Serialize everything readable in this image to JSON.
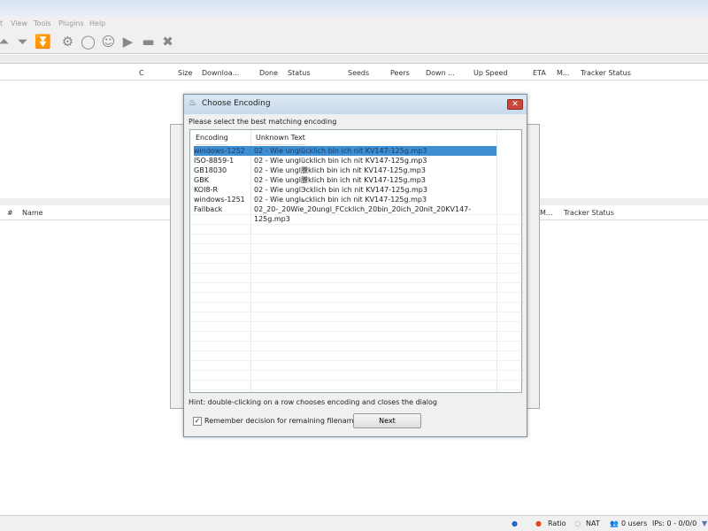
{
  "menu": [
    "t",
    "View",
    "Tools",
    "Plugins",
    "Help"
  ],
  "toolbar_icons": [
    "add-icon",
    "remove-icon",
    "remove-all-icon",
    "settings-icon",
    "resume-icon",
    "pause-icon",
    "play-icon",
    "stop-icon",
    "close-icon"
  ],
  "top_columns": [
    "C",
    "Size",
    "Downloa...",
    "Done",
    "Status",
    "Seeds",
    "Peers",
    "Down ...",
    "Up Speed",
    "ETA",
    "M...",
    "Tracker Status"
  ],
  "lower_columns": [
    "#",
    "Name",
    "M...",
    "Tracker Status"
  ],
  "dialog": {
    "title": "Choose Encoding",
    "prompt": "Please select the best matching encoding",
    "columns": [
      "Encoding",
      "Unknown Text"
    ],
    "rows": [
      {
        "encoding": "windows-1252",
        "text": "02 - Wie unglücklich bin ich nit KV147-125g.mp3",
        "selected": true
      },
      {
        "encoding": "ISO-8859-1",
        "text": "02 - Wie unglücklich bin ich nit KV147-125g.mp3"
      },
      {
        "encoding": "GB18030",
        "text": "02 - Wie ungl黱klich bin ich nit KV147-125g.mp3"
      },
      {
        "encoding": "GBK",
        "text": "02 - Wie ungl黱klich bin ich nit KV147-125g.mp3"
      },
      {
        "encoding": "KOI8-R",
        "text": "02 - Wie unglЭcklich bin ich nit KV147-125g.mp3"
      },
      {
        "encoding": "windows-1251",
        "text": "02 - Wie unglьcklich bin ich nit KV147-125g.mp3"
      },
      {
        "encoding": "Fallback",
        "text": "02_20-_20Wie_20ungl_FCcklich_20bin_20ich_20nit_20KV147-125g.mp3"
      }
    ],
    "hint": "Hint: double-clicking on a row chooses encoding and closes the dialog",
    "remember_label": "Remember decision for remaining filenames",
    "remember_checked": true,
    "next_label": "Next",
    "close_symbol": "✕"
  },
  "status": {
    "ratio": "Ratio",
    "nat": "NAT",
    "users": "0 users",
    "ips": "IPs: 0 - 0/0/0"
  },
  "colors": {
    "selection": "#3e8fd2",
    "ratio_dot": "#e04a1a"
  }
}
